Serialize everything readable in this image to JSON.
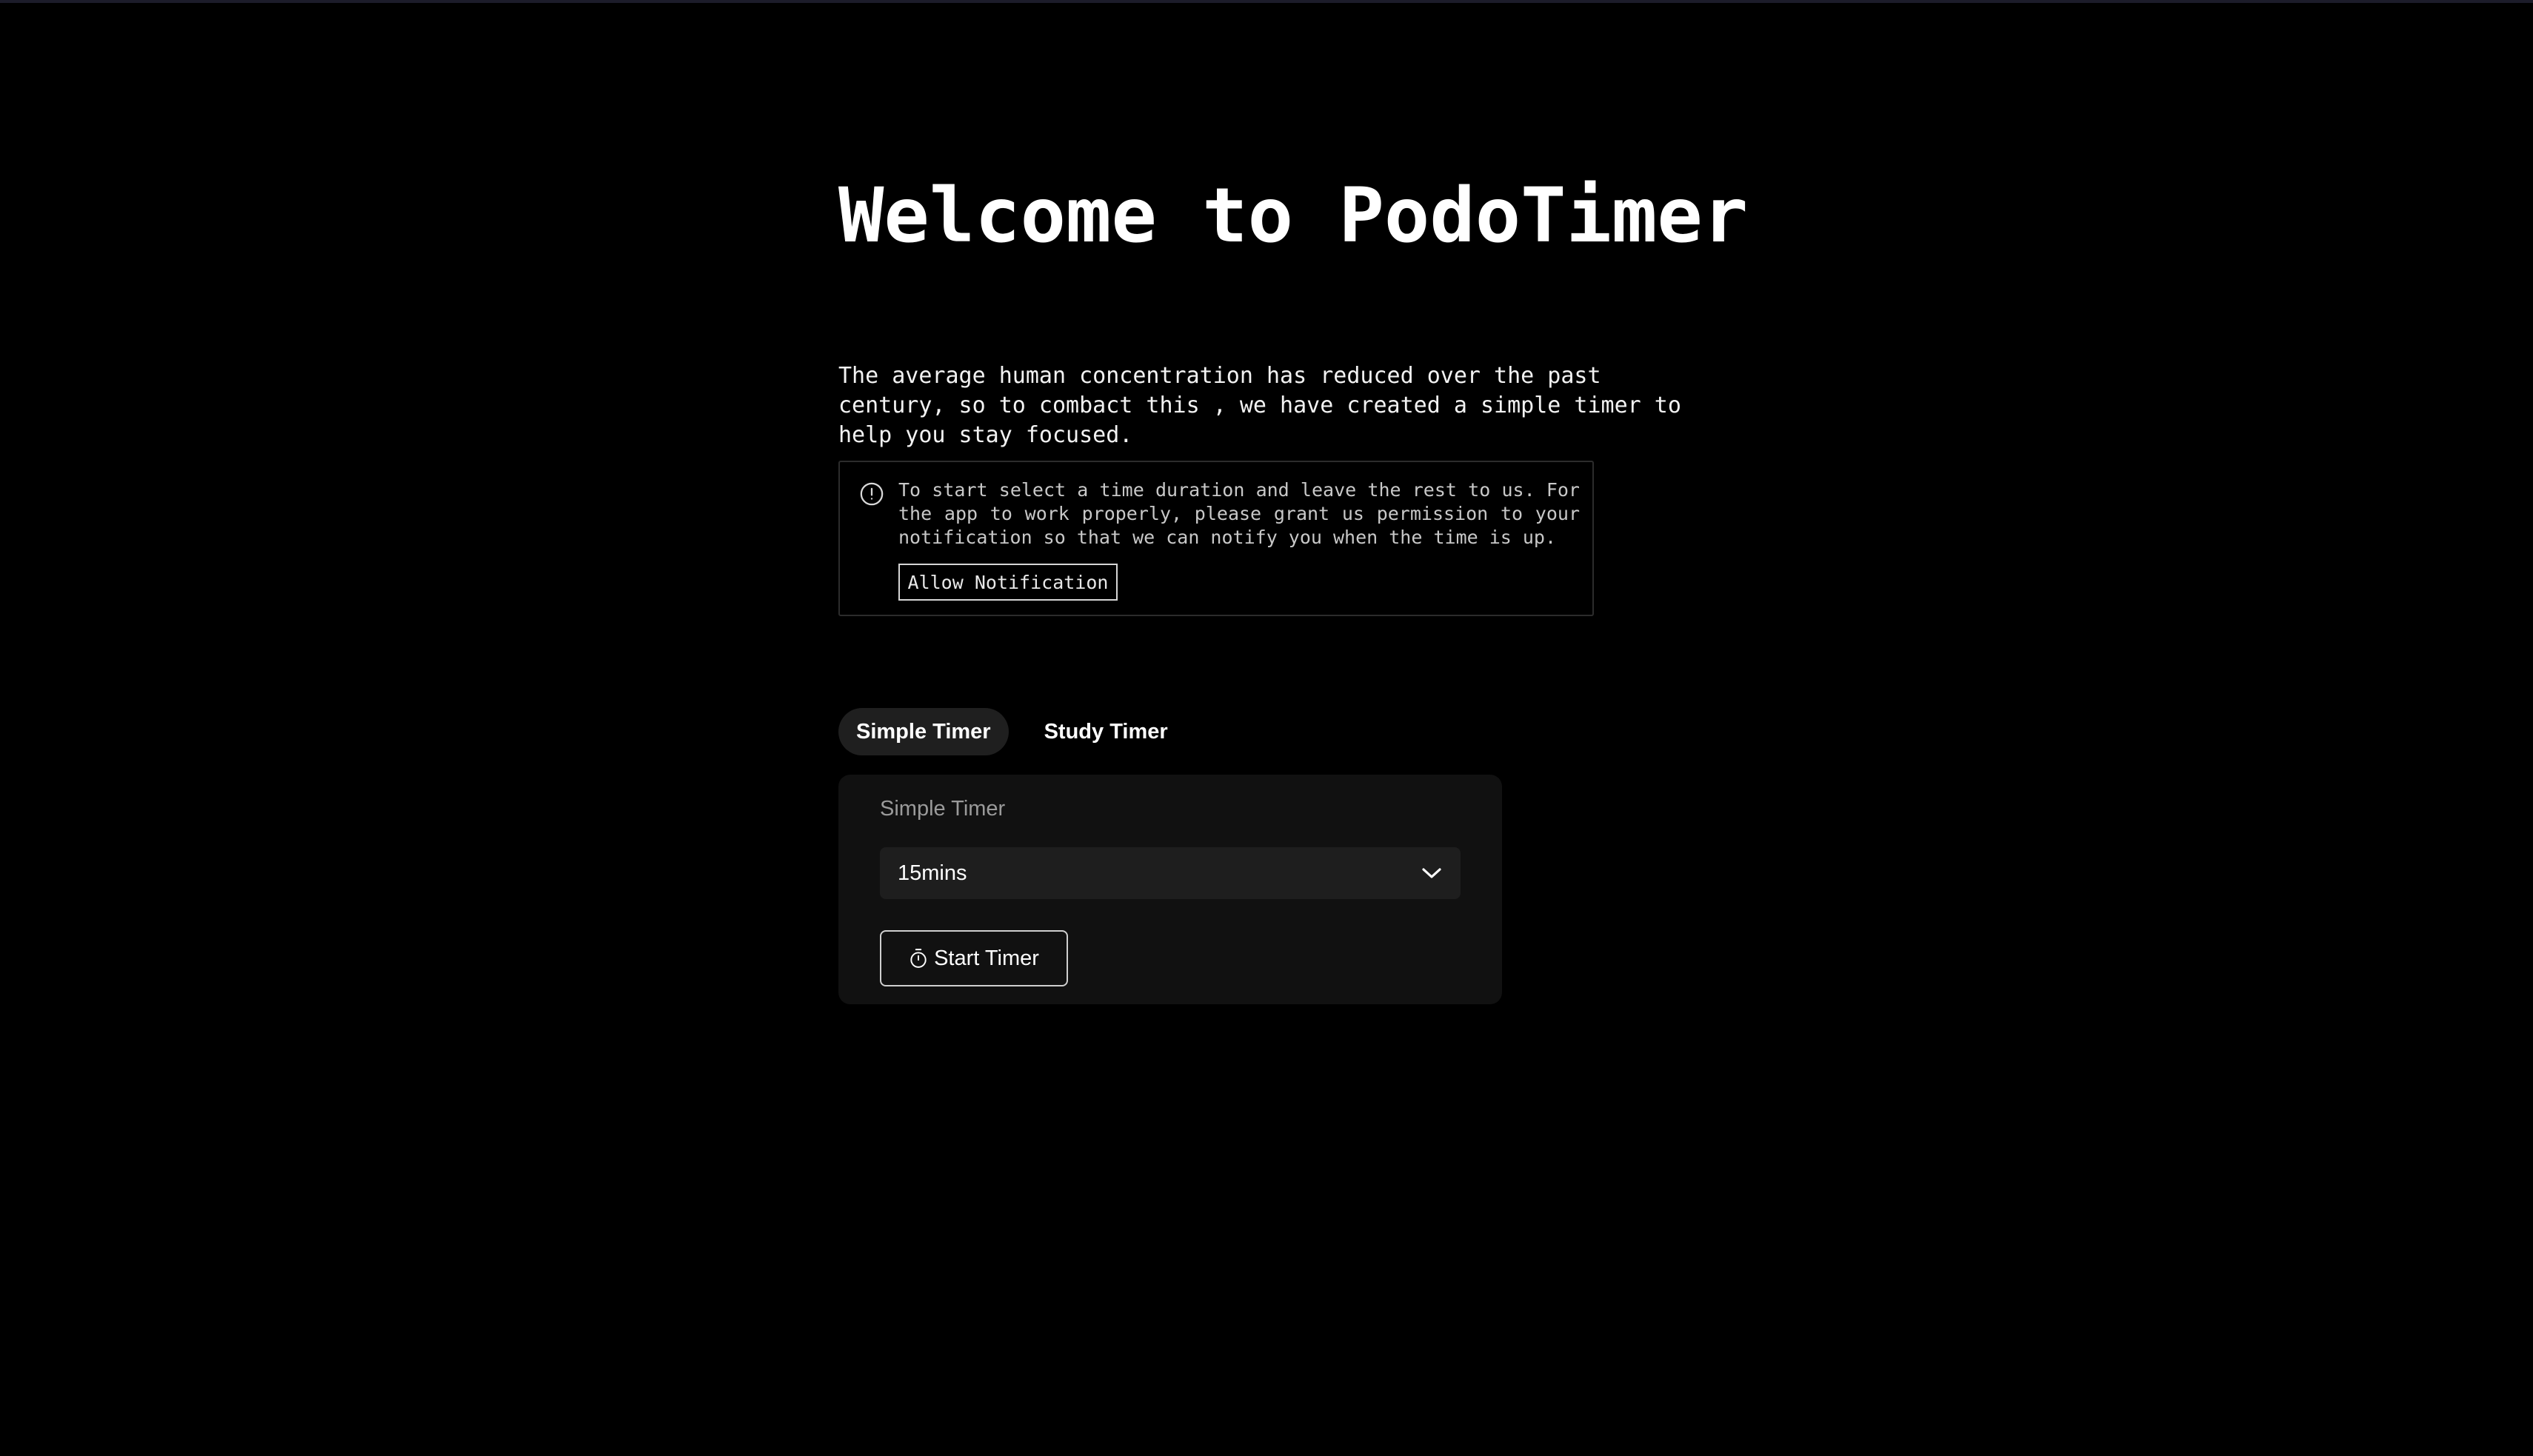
{
  "header": {
    "title": "Welcome to PodoTimer"
  },
  "intro": {
    "text": "The average human concentration has reduced over the past century, so to combact this , we have created a simple timer to help you stay focused."
  },
  "alert": {
    "icon": "alert-circle-icon",
    "text": "To start select a time duration and leave the rest to us. For the app to work properly, please grant us permission to your notification so that we can notify you when the time is up.",
    "button_label": "Allow Notification"
  },
  "tabs": [
    {
      "label": "Simple Timer",
      "active": true
    },
    {
      "label": "Study Timer",
      "active": false
    }
  ],
  "card": {
    "label": "Simple Timer",
    "duration_selected": "15mins",
    "dropdown_icon": "chevron-down-icon",
    "start_button_icon": "timer-icon",
    "start_button_label": "Start Timer"
  },
  "colors": {
    "background": "#000000",
    "card_background": "#111111",
    "select_background": "#1e1e1e",
    "active_tab_background": "#1f1f1f",
    "muted_text": "#9a9a9a"
  }
}
